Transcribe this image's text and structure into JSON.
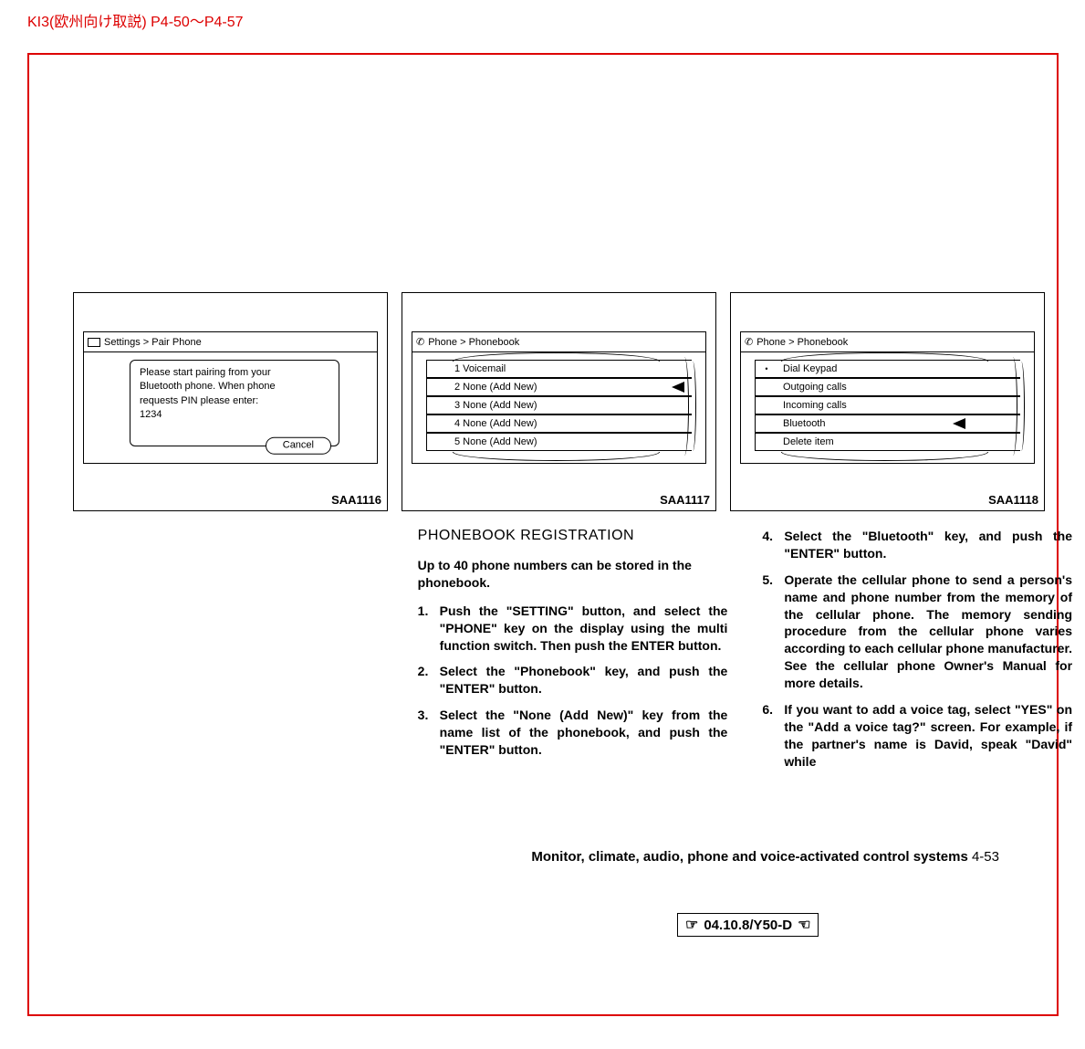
{
  "header": "KI3(欧州向け取説) P4-50～P4-57",
  "figures": {
    "fig1": {
      "label": "SAA1116",
      "breadcrumb": "Settings   > Pair Phone",
      "popup_line1": "Please start pairing from your",
      "popup_line2": "Bluetooth phone. When phone",
      "popup_line3": "requests PIN please enter:",
      "popup_pin": "1234",
      "popup_cancel": "Cancel"
    },
    "fig2": {
      "label": "SAA1117",
      "breadcrumb": "Phone > Phonebook",
      "items": [
        "1 Voicemail",
        "2 None (Add New)",
        "3 None (Add New)",
        "4 None (Add New)",
        "5 None (Add New)"
      ]
    },
    "fig3": {
      "label": "SAA1118",
      "breadcrumb": "Phone > Phonebook",
      "items": [
        "Dial Keypad",
        "Outgoing calls",
        "Incoming calls",
        "Bluetooth",
        "Delete item"
      ]
    }
  },
  "section": {
    "title": "PHONEBOOK REGISTRATION",
    "intro": "Up to 40 phone numbers can be stored in the phonebook.",
    "step1": "Push the \"SETTING\" button, and select the \"PHONE\" key on the display using the multi function switch. Then push the ENTER button.",
    "step2": "Select the \"Phonebook\" key, and push the \"ENTER\" button.",
    "step3": "Select the \"None (Add New)\" key from the name list of the phonebook, and push the \"ENTER\" button.",
    "step4": "Select the \"Bluetooth\" key, and push the \"ENTER\" button.",
    "step5": "Operate the cellular phone to send a person's name and phone number from the memory of the cellular phone. The memory sending procedure from the cellular phone varies according to each cellular phone manufacturer. See the cellular phone Owner's Manual for more details.",
    "step6": "If you want to add a voice tag, select \"YES\" on the \"Add a voice tag?\" screen. For example, if the partner's name is David, speak \"David\" while"
  },
  "footer": {
    "chapter": "Monitor, climate, audio, phone and voice-activated control systems",
    "page": "4-53"
  },
  "revision": "04.10.8/Y50-D"
}
